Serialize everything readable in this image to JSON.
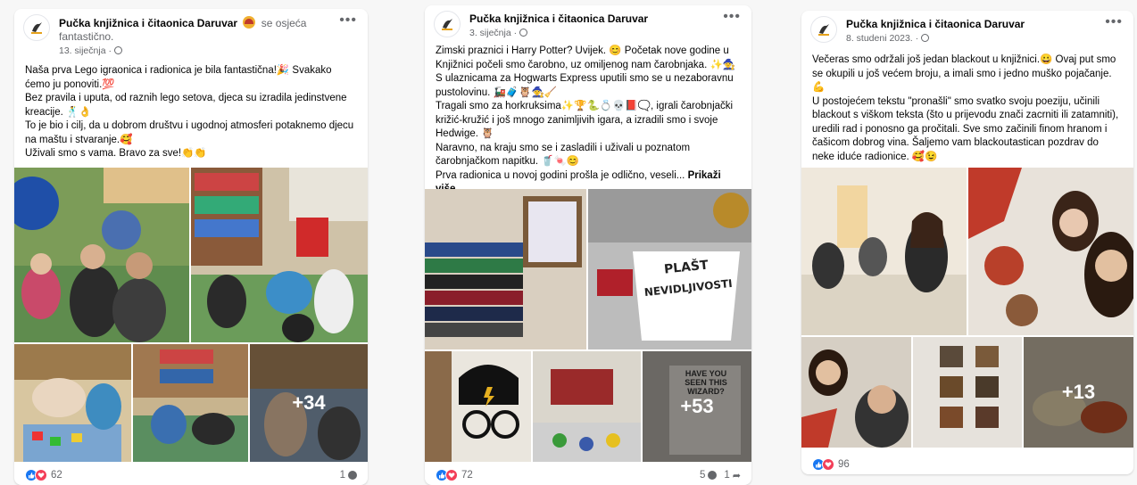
{
  "posts": [
    {
      "page_name": "Pučka knjižnica i čitaonica Daruvar",
      "feeling": "se osjeća fantastično.",
      "date": "13. siječnja",
      "text": "Naša prva Lego igraonica i radionica je bila fantastična!🎉 Svakako ćemo ju ponoviti.💯\nBez pravila i uputa, od raznih lego setova, djeca su izradila jedinstvene kreacije. 🕺👌\nTo je bio i cilj, da u dobrom društvu i ugodnoj atmosferi potaknemo djecu na maštu i stvaranje.🥰\nUživali smo s vama. Bravo za sve!👏👏",
      "more_photos": "+34",
      "reaction_count": "62",
      "comment_count": "1"
    },
    {
      "page_name": "Pučka knjižnica i čitaonica Daruvar",
      "date": "3. siječnja",
      "text": "Zimski praznici i Harry Potter? Uvijek. 😊 Početak nove godine u Knjižnici počeli smo čarobno, uz omiljenog nam čarobnjaka. ✨🧙\nS ulaznicama za Hogwarts Express uputili smo se u nezaboravnu pustolovinu. 🚂🧳🦉🧙🧹\nTragali smo za horkruksima✨🏆🐍💍💀📕🗨️, igrali čarobnjački križić-kružić i još mnogo zanimljivih igara, a izradili smo i svoje Hedwige. 🦉\nNaravno, na kraju smo se i zasladili i uživali u poznatom čarobnjačkom napitku. 🥤🍬😊\nPrva radionica u novoj godini prošla je odlično, veseli...",
      "see_more": "Prikaži više",
      "sign_line1": "PLAŠT",
      "sign_line2": "NEVIDLJIVOSTI",
      "poster_text": "HAVE YOU SEEN THIS WIZARD?",
      "more_photos": "+53",
      "reaction_count": "72",
      "comment_count": "5",
      "share_count": "1"
    },
    {
      "page_name": "Pučka knjižnica i čitaonica Daruvar",
      "date": "8. studeni 2023.",
      "text": "Večeras smo održali još jedan blackout u knjižnici.😀 Ovaj put smo se okupili u još većem broju, a imali smo i jedno muško pojačanje. 💪\nU postojećem tekstu \"pronašli\" smo svatko svoju poeziju, učinili blackout s viškom teksta (što u prijevodu znači zacrniti ili zatamniti), uredili rad i ponosno ga pročitali. Sve smo začinili finom hranom i čašicom dobrog vina. Šaljemo vam blackoutastican pozdrav do neke iduće radionice. 🥰😉",
      "more_photos": "+13",
      "reaction_count": "96"
    }
  ],
  "colors": {
    "like": "#1877f2",
    "love": "#f33e58",
    "meta": "#65676b"
  },
  "icons": [
    "stork-logo-icon",
    "globe-icon",
    "more-options-icon",
    "like-icon",
    "love-icon",
    "comment-icon",
    "share-icon"
  ]
}
